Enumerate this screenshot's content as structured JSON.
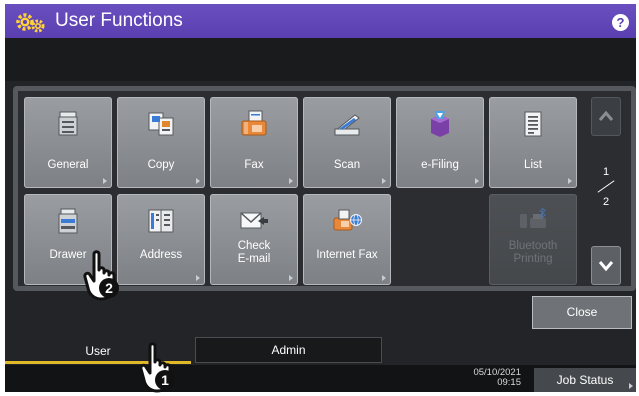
{
  "title_bar": {
    "title": "User Functions",
    "help_glyph": "?",
    "icon": "gear-icon"
  },
  "functions": [
    {
      "label": "General",
      "icon": "copier-icon",
      "enabled": true
    },
    {
      "label": "Copy",
      "icon": "copy-icon",
      "enabled": true
    },
    {
      "label": "Fax",
      "icon": "fax-icon",
      "enabled": true
    },
    {
      "label": "Scan",
      "icon": "scanner-icon",
      "enabled": true
    },
    {
      "label": "e-Filing",
      "icon": "e-filing-icon",
      "enabled": true
    },
    {
      "label": "List",
      "icon": "list-icon",
      "enabled": true
    },
    {
      "label": "Drawer",
      "icon": "drawer-icon",
      "enabled": true
    },
    {
      "label": "Address",
      "icon": "address-book-icon",
      "enabled": true
    },
    {
      "label_line1": "Check",
      "label_line2": "E-mail",
      "icon": "envelope-icon",
      "enabled": true
    },
    {
      "label": "Internet Fax",
      "icon": "internet-fax-icon",
      "enabled": true
    },
    {
      "label_line1": "Bluetooth",
      "label_line2": "Printing",
      "icon": "bluetooth-printer-icon",
      "enabled": false
    }
  ],
  "pagination": {
    "current": "1",
    "total": "2"
  },
  "close_label": "Close",
  "tabs": {
    "user": "User",
    "admin": "Admin",
    "active": "User"
  },
  "footer": {
    "date": "05/10/2021",
    "time": "09:15",
    "job_status_label": "Job Status"
  },
  "callouts": {
    "step1": "1",
    "step2": "2"
  },
  "colors": {
    "title_bar": "#5a3fb0",
    "active_tab_underline": "#e0b828",
    "screen_bg": "#222427"
  }
}
